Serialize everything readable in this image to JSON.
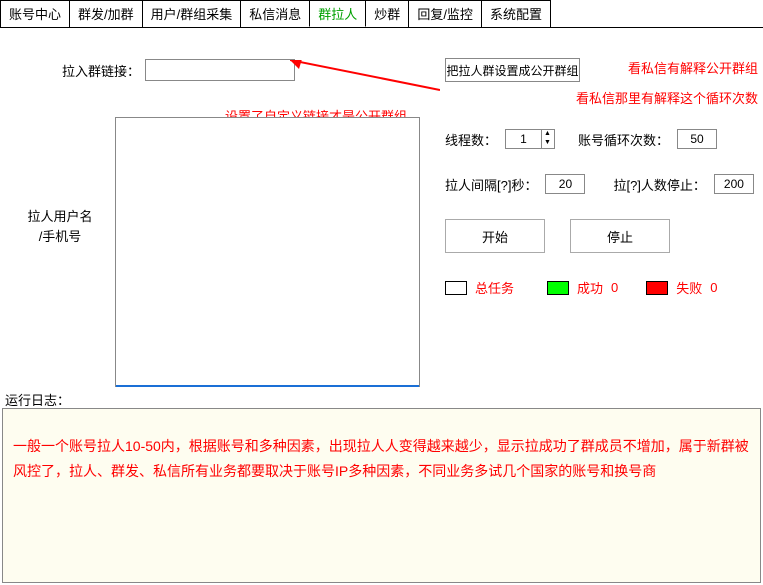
{
  "tabs": {
    "t0": "账号中心",
    "t1": "群发/加群",
    "t2": "用户/群组采集",
    "t3": "私信消息",
    "t4": "群拉人",
    "t5": "炒群",
    "t6": "回复/监控",
    "t7": "系统配置"
  },
  "form": {
    "link_label": "拉入群链接：",
    "link_value": "",
    "set_public_btn": "把拉人群设置成公开群组",
    "left_label_1": "拉人用户名",
    "left_label_2": "/手机号",
    "textarea_value": ""
  },
  "params": {
    "threads_label": "线程数：",
    "threads_value": "1",
    "loop_label": "账号循环次数：",
    "loop_value": "50",
    "interval_label": "拉人间隔[?]秒：",
    "interval_value": "20",
    "stop_label": "拉[?]人数停止：",
    "stop_value": "200"
  },
  "buttons": {
    "start": "开始",
    "stop": "停止"
  },
  "status": {
    "total_label": "总任务",
    "success_label": "成功",
    "success_count": "0",
    "fail_label": "失败",
    "fail_count": "0"
  },
  "notes": {
    "n1": "看私信有解释公开群组",
    "n2": "看私信那里有解释这个循环次数",
    "n3": "设置了自定义链接才是公开群组"
  },
  "log": {
    "label": "运行日志：",
    "text": "一般一个账号拉人10-50内，根据账号和多种因素，出现拉人人变得越来越少，显示拉成功了群成员不增加，属于新群被风控了，拉人、群发、私信所有业务都要取决于账号IP多种因素，不同业务多试几个国家的账号和换号商"
  }
}
